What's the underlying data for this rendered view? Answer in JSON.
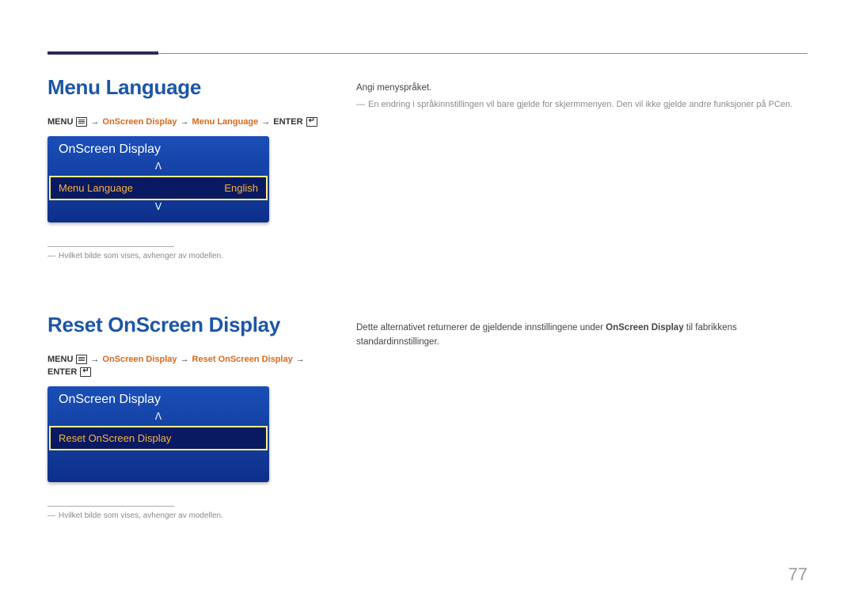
{
  "page_number": "77",
  "section1": {
    "heading": "Menu Language",
    "breadcrumb": {
      "pre": "MENU",
      "path1": "OnScreen Display",
      "path2": "Menu Language",
      "post": "ENTER"
    },
    "osd": {
      "title": "OnScreen Display",
      "item_label": "Menu Language",
      "item_value": "English"
    },
    "footnote": "Hvilket bilde som vises, avhenger av modellen.",
    "body_line1": "Angi menyspråket.",
    "body_note": "En endring i språkinnstillingen vil bare gjelde for skjermmenyen. Den vil ikke gjelde andre funksjoner på PCen."
  },
  "section2": {
    "heading": "Reset OnScreen Display",
    "breadcrumb": {
      "pre": "MENU",
      "path1": "OnScreen Display",
      "path2": "Reset OnScreen Display",
      "post": "ENTER"
    },
    "osd": {
      "title": "OnScreen Display",
      "item_label": "Reset OnScreen Display"
    },
    "footnote": "Hvilket bilde som vises, avhenger av modellen.",
    "body_pre": "Dette alternativet returnerer de gjeldende innstillingene under ",
    "body_strong": "OnScreen Display",
    "body_post": " til fabrikkens standardinnstillinger."
  },
  "arrows": {
    "sep": "→",
    "up": "ᐱ",
    "down": "ᐯ",
    "dash": "―"
  }
}
